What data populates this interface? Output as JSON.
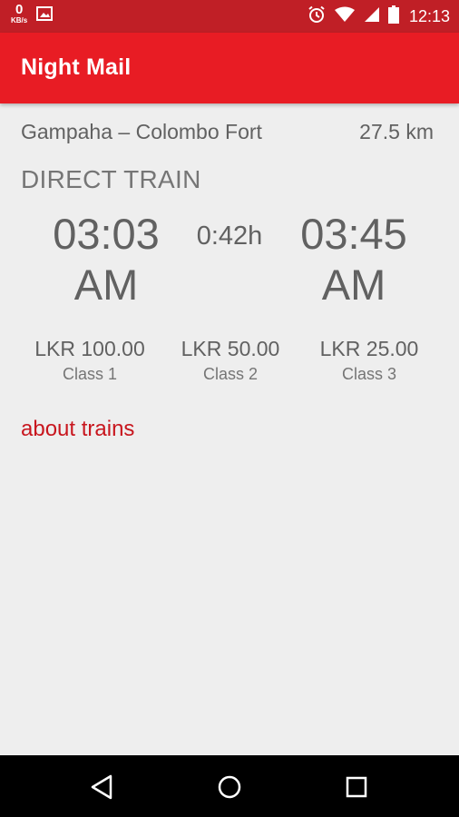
{
  "status_bar": {
    "net_speed_value": "0",
    "net_speed_unit": "KB/s",
    "time": "12:13",
    "background": "#c01f26",
    "icons": [
      "image-icon",
      "alarm-icon",
      "wifi-icon",
      "signal-icon",
      "battery-icon"
    ]
  },
  "app_bar": {
    "title": "Night Mail",
    "background": "#e81c24"
  },
  "route": {
    "from_to": "Gampaha – Colombo Fort",
    "distance": "27.5 km"
  },
  "train": {
    "type": "DIRECT TRAIN",
    "departure_time": "03:03",
    "departure_period": "AM",
    "duration": "0:42h",
    "arrival_time": "03:45",
    "arrival_period": "AM"
  },
  "fares": [
    {
      "price": "LKR 100.00",
      "class": "Class 1"
    },
    {
      "price": "LKR 50.00",
      "class": "Class 2"
    },
    {
      "price": "LKR 25.00",
      "class": "Class 3"
    }
  ],
  "links": {
    "about_trains": "about trains",
    "color": "#c8161e"
  },
  "nav_bar": {
    "icons": [
      "back-icon",
      "home-icon",
      "recents-icon"
    ]
  }
}
